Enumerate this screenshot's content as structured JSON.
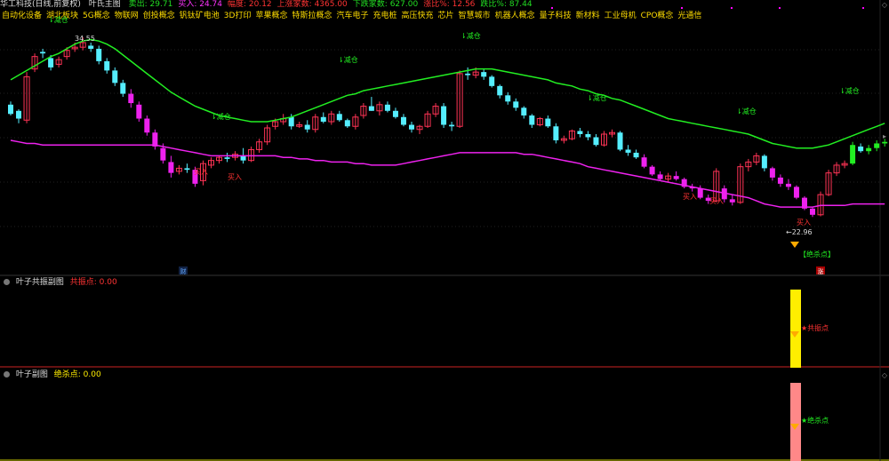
{
  "header": {
    "stock_name": "华工科技(日线,前复权)",
    "indicator": "叶氏主图",
    "items": [
      {
        "label": "卖出: 29.71",
        "color": "#22dd22"
      },
      {
        "label": "买入: 24.74",
        "color": "#ff33ff"
      },
      {
        "label": "幅度: 20.12",
        "color": "#ff3333"
      },
      {
        "label": "上涨家数: 4365.00",
        "color": "#ff3333"
      },
      {
        "label": "下跌家数: 627.00",
        "color": "#22dd22"
      },
      {
        "label": "涨比%: 12.56",
        "color": "#ff3333"
      },
      {
        "label": "跌比%: 87.44",
        "color": "#22dd22"
      }
    ]
  },
  "concepts": [
    "自动化设备",
    "湖北板块",
    "5G概念",
    "物联网",
    "创投概念",
    "钒钛矿电池",
    "3D打印",
    "苹果概念",
    "特斯拉概念",
    "汽车电子",
    "充电桩",
    "高压快充",
    "芯片",
    "智慧城市",
    "机器人概念",
    "量子科技",
    "新材料",
    "工业母机",
    "CPO概念",
    "光通信"
  ],
  "colors": {
    "up": "#ff3355",
    "down": "#55eeff",
    "green_line": "#22ee22",
    "magenta_line": "#ee22ee",
    "accent_yellow": "#ffee00",
    "accent_pink": "#ff8888"
  },
  "main_chart": {
    "high_label": "34.55",
    "low_label": "←22.96",
    "sell_signal_label": "⇂减仓",
    "buy_signal_label": "买入",
    "kill_point_label": "【绝杀点】",
    "fin_badge": "财",
    "up_badge": "涨"
  },
  "panel1": {
    "title": "叶子共振副图",
    "value_label": "共振点: 0.00",
    "marker_label": "★共振点"
  },
  "panel2": {
    "title": "叶子副图",
    "value_label": "绝杀点: 0.00",
    "marker_label": "★绝杀点"
  },
  "chart_data": {
    "type": "candlestick",
    "y_range_note": "price, low 22.96, high 34.55",
    "ohlc": [
      [
        30.2,
        30.4,
        29.5,
        29.6
      ],
      [
        29.8,
        29.9,
        29.0,
        29.3
      ],
      [
        29.2,
        32.3,
        29.0,
        32.0
      ],
      [
        32.5,
        33.5,
        32.3,
        33.3
      ],
      [
        33.6,
        33.8,
        33.2,
        33.5
      ],
      [
        33.2,
        33.4,
        32.4,
        32.6
      ],
      [
        32.8,
        33.3,
        32.6,
        33.1
      ],
      [
        33.3,
        33.9,
        33.1,
        33.7
      ],
      [
        33.8,
        34.2,
        33.6,
        33.9
      ],
      [
        33.9,
        34.55,
        33.7,
        34.2
      ],
      [
        34.0,
        34.2,
        33.6,
        33.8
      ],
      [
        33.8,
        34.0,
        32.8,
        33.0
      ],
      [
        33.0,
        33.2,
        32.2,
        32.4
      ],
      [
        32.4,
        32.6,
        31.4,
        31.6
      ],
      [
        31.6,
        31.8,
        30.7,
        30.9
      ],
      [
        30.9,
        31.2,
        30.0,
        30.3
      ],
      [
        30.2,
        30.4,
        29.1,
        29.3
      ],
      [
        29.3,
        29.5,
        28.2,
        28.4
      ],
      [
        28.4,
        28.6,
        27.3,
        27.5
      ],
      [
        27.4,
        27.7,
        26.4,
        26.6
      ],
      [
        26.5,
        26.9,
        25.5,
        25.8
      ],
      [
        25.9,
        26.3,
        25.7,
        26.1
      ],
      [
        26.1,
        26.4,
        25.8,
        26.0
      ],
      [
        26.0,
        26.2,
        24.9,
        25.1
      ],
      [
        25.3,
        26.6,
        25.0,
        26.4
      ],
      [
        26.3,
        26.8,
        26.1,
        26.6
      ],
      [
        26.6,
        26.9,
        26.4,
        26.8
      ],
      [
        26.8,
        27.1,
        26.5,
        26.7
      ],
      [
        26.8,
        27.2,
        26.6,
        27.0
      ],
      [
        26.9,
        27.4,
        26.4,
        26.6
      ],
      [
        26.6,
        27.5,
        26.5,
        27.3
      ],
      [
        27.3,
        28.0,
        27.1,
        27.8
      ],
      [
        27.8,
        28.9,
        27.6,
        28.7
      ],
      [
        28.8,
        29.3,
        28.6,
        29.1
      ],
      [
        29.1,
        29.6,
        28.9,
        29.3
      ],
      [
        29.4,
        29.6,
        28.6,
        28.8
      ],
      [
        28.8,
        29.1,
        28.7,
        28.9
      ],
      [
        28.9,
        29.2,
        28.4,
        28.6
      ],
      [
        28.6,
        29.6,
        28.4,
        29.4
      ],
      [
        29.4,
        29.7,
        29.0,
        29.1
      ],
      [
        29.1,
        29.8,
        28.9,
        29.6
      ],
      [
        29.6,
        29.8,
        29.1,
        29.2
      ],
      [
        29.2,
        29.3,
        28.7,
        28.8
      ],
      [
        28.8,
        29.6,
        28.6,
        29.4
      ],
      [
        29.5,
        30.3,
        29.3,
        30.1
      ],
      [
        30.1,
        30.7,
        29.8,
        29.8
      ],
      [
        29.8,
        30.4,
        29.5,
        30.2
      ],
      [
        30.2,
        30.4,
        29.7,
        29.8
      ],
      [
        29.8,
        30.0,
        29.3,
        29.4
      ],
      [
        29.4,
        29.6,
        28.8,
        28.9
      ],
      [
        28.9,
        29.1,
        28.4,
        28.6
      ],
      [
        28.6,
        28.9,
        28.3,
        28.8
      ],
      [
        28.8,
        29.8,
        28.7,
        29.6
      ],
      [
        29.6,
        30.3,
        29.4,
        30.1
      ],
      [
        30.1,
        30.3,
        28.7,
        28.9
      ],
      [
        28.9,
        29.1,
        28.5,
        28.8
      ],
      [
        28.8,
        32.4,
        28.7,
        32.2
      ],
      [
        32.2,
        32.6,
        31.8,
        32.1
      ],
      [
        32.1,
        32.6,
        31.9,
        32.3
      ],
      [
        32.3,
        32.5,
        31.8,
        32.0
      ],
      [
        32.0,
        32.1,
        31.3,
        31.4
      ],
      [
        31.4,
        31.5,
        30.6,
        30.8
      ],
      [
        30.8,
        31.0,
        30.2,
        30.4
      ],
      [
        30.4,
        30.6,
        29.8,
        30.0
      ],
      [
        30.0,
        30.1,
        29.3,
        29.5
      ],
      [
        29.5,
        29.6,
        28.7,
        28.9
      ],
      [
        28.9,
        29.4,
        28.8,
        29.3
      ],
      [
        29.3,
        29.5,
        28.7,
        28.8
      ],
      [
        28.8,
        29.0,
        27.7,
        27.9
      ],
      [
        27.9,
        28.2,
        27.7,
        28.0
      ],
      [
        28.0,
        28.6,
        27.9,
        28.5
      ],
      [
        28.5,
        28.7,
        28.1,
        28.3
      ],
      [
        28.3,
        28.5,
        27.9,
        28.1
      ],
      [
        28.1,
        28.3,
        27.5,
        27.6
      ],
      [
        27.6,
        28.5,
        27.5,
        28.3
      ],
      [
        28.3,
        28.6,
        28.1,
        28.4
      ],
      [
        28.4,
        28.5,
        27.2,
        27.3
      ],
      [
        27.3,
        27.6,
        26.9,
        27.1
      ],
      [
        27.1,
        27.3,
        26.7,
        26.8
      ],
      [
        26.8,
        27.0,
        26.1,
        26.2
      ],
      [
        26.2,
        26.3,
        25.6,
        25.7
      ],
      [
        25.7,
        25.9,
        25.3,
        25.4
      ],
      [
        25.4,
        25.8,
        25.2,
        25.6
      ],
      [
        25.6,
        25.9,
        25.3,
        25.4
      ],
      [
        25.4,
        25.5,
        24.8,
        24.9
      ],
      [
        24.9,
        25.1,
        24.6,
        24.8
      ],
      [
        24.8,
        25.0,
        24.1,
        24.2
      ],
      [
        24.2,
        24.4,
        23.8,
        24.0
      ],
      [
        24.0,
        26.1,
        23.9,
        25.9
      ],
      [
        24.8,
        25.0,
        23.9,
        24.1
      ],
      [
        24.1,
        24.4,
        23.7,
        23.9
      ],
      [
        23.9,
        26.4,
        23.8,
        26.2
      ],
      [
        26.2,
        26.7,
        25.9,
        26.5
      ],
      [
        26.5,
        27.1,
        26.3,
        26.9
      ],
      [
        26.9,
        27.0,
        25.9,
        26.1
      ],
      [
        26.1,
        26.2,
        25.3,
        25.5
      ],
      [
        25.5,
        25.7,
        24.9,
        25.1
      ],
      [
        25.1,
        25.4,
        24.7,
        24.9
      ],
      [
        24.9,
        25.0,
        24.1,
        24.2
      ],
      [
        24.2,
        24.3,
        23.4,
        23.5
      ],
      [
        23.5,
        23.6,
        22.96,
        23.1
      ],
      [
        23.1,
        24.6,
        23.0,
        24.4
      ],
      [
        24.4,
        26.0,
        24.3,
        25.8
      ],
      [
        25.8,
        26.5,
        25.6,
        26.3
      ],
      [
        26.3,
        26.6,
        26.1,
        26.4
      ],
      [
        26.4,
        27.8,
        26.3,
        27.6
      ],
      [
        27.5,
        27.7,
        27.1,
        27.2
      ],
      [
        27.2,
        27.6,
        27.0,
        27.4
      ],
      [
        27.4,
        27.9,
        27.2,
        27.7
      ],
      [
        27.7,
        28.0,
        27.5,
        27.8
      ]
    ],
    "sell_line": [
      31.8,
      32.1,
      32.4,
      32.7,
      33.0,
      33.3,
      33.5,
      33.8,
      34.1,
      34.3,
      34.4,
      34.3,
      34.1,
      33.8,
      33.4,
      33.0,
      32.6,
      32.2,
      31.8,
      31.4,
      31.0,
      30.7,
      30.4,
      30.1,
      29.9,
      29.7,
      29.5,
      29.4,
      29.3,
      29.2,
      29.1,
      29.1,
      29.1,
      29.2,
      29.3,
      29.4,
      29.6,
      29.8,
      30.0,
      30.2,
      30.4,
      30.6,
      30.8,
      30.9,
      31.1,
      31.2,
      31.3,
      31.4,
      31.5,
      31.6,
      31.7,
      31.8,
      31.9,
      32.0,
      32.1,
      32.2,
      32.3,
      32.4,
      32.5,
      32.5,
      32.5,
      32.4,
      32.3,
      32.2,
      32.1,
      32.0,
      31.9,
      31.8,
      31.6,
      31.5,
      31.4,
      31.2,
      31.1,
      30.9,
      30.8,
      30.6,
      30.5,
      30.3,
      30.1,
      29.9,
      29.7,
      29.5,
      29.3,
      29.2,
      29.1,
      29.0,
      28.9,
      28.8,
      28.7,
      28.6,
      28.5,
      28.4,
      28.3,
      28.1,
      27.9,
      27.7,
      27.6,
      27.5,
      27.4,
      27.4,
      27.4,
      27.5,
      27.6,
      27.8,
      28.0,
      28.2,
      28.4,
      28.6,
      28.8,
      29.0
    ],
    "buy_line": [
      27.9,
      27.8,
      27.7,
      27.7,
      27.6,
      27.6,
      27.6,
      27.6,
      27.6,
      27.6,
      27.6,
      27.6,
      27.6,
      27.6,
      27.6,
      27.6,
      27.6,
      27.6,
      27.6,
      27.5,
      27.4,
      27.3,
      27.2,
      27.1,
      27.0,
      26.9,
      26.9,
      26.9,
      26.9,
      26.9,
      26.9,
      26.9,
      26.9,
      26.9,
      26.8,
      26.8,
      26.7,
      26.7,
      26.6,
      26.6,
      26.5,
      26.5,
      26.5,
      26.4,
      26.4,
      26.3,
      26.3,
      26.3,
      26.3,
      26.4,
      26.5,
      26.6,
      26.7,
      26.8,
      26.9,
      27.0,
      27.1,
      27.1,
      27.1,
      27.1,
      27.1,
      27.1,
      27.1,
      27.1,
      27.0,
      27.0,
      26.9,
      26.8,
      26.7,
      26.6,
      26.5,
      26.4,
      26.2,
      26.1,
      26.0,
      25.9,
      25.8,
      25.7,
      25.6,
      25.5,
      25.4,
      25.3,
      25.2,
      25.1,
      25.0,
      24.9,
      24.8,
      24.7,
      24.6,
      24.5,
      24.4,
      24.3,
      24.2,
      24.0,
      23.8,
      23.7,
      23.6,
      23.6,
      23.6,
      23.6,
      23.6,
      23.7,
      23.7,
      23.7,
      23.7,
      23.8,
      23.8,
      23.8,
      23.8,
      23.8
    ]
  }
}
